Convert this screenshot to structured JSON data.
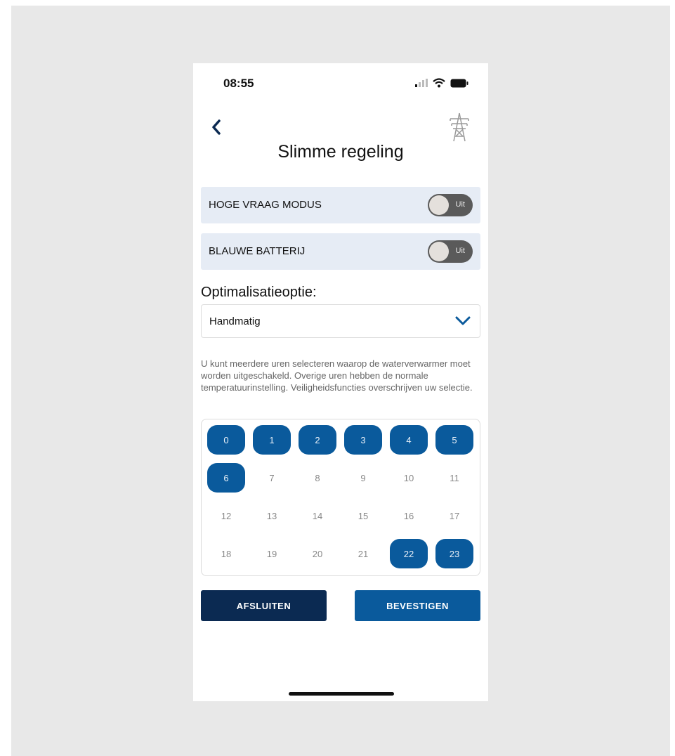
{
  "status_bar": {
    "time": "08:55",
    "icons": [
      "signal-icon",
      "wifi-icon",
      "battery-icon"
    ]
  },
  "header": {
    "back_icon": "chevron-left-icon",
    "right_icon": "power-pylon-icon",
    "title": "Slimme regeling"
  },
  "toggles": [
    {
      "label": "HOGE VRAAG MODUS",
      "state_text": "Uit",
      "on": false
    },
    {
      "label": "BLAUWE BATTERIJ",
      "state_text": "Uit",
      "on": false
    }
  ],
  "optimization": {
    "label": "Optimalisatieoptie:",
    "selected": "Handmatig",
    "chevron_icon": "chevron-down-icon"
  },
  "description": "U kunt meerdere uren selecteren waarop de waterverwarmer moet worden uitgeschakeld. Overige uren hebben de normale temperatuurinstelling. Veiligheidsfuncties overschrijven uw selectie.",
  "hours": [
    {
      "label": "0",
      "selected": true
    },
    {
      "label": "1",
      "selected": true
    },
    {
      "label": "2",
      "selected": true
    },
    {
      "label": "3",
      "selected": true
    },
    {
      "label": "4",
      "selected": true
    },
    {
      "label": "5",
      "selected": true
    },
    {
      "label": "6",
      "selected": true
    },
    {
      "label": "7",
      "selected": false
    },
    {
      "label": "8",
      "selected": false
    },
    {
      "label": "9",
      "selected": false
    },
    {
      "label": "10",
      "selected": false
    },
    {
      "label": "11",
      "selected": false
    },
    {
      "label": "12",
      "selected": false
    },
    {
      "label": "13",
      "selected": false
    },
    {
      "label": "14",
      "selected": false
    },
    {
      "label": "15",
      "selected": false
    },
    {
      "label": "16",
      "selected": false
    },
    {
      "label": "17",
      "selected": false
    },
    {
      "label": "18",
      "selected": false
    },
    {
      "label": "19",
      "selected": false
    },
    {
      "label": "20",
      "selected": false
    },
    {
      "label": "21",
      "selected": false
    },
    {
      "label": "22",
      "selected": true
    },
    {
      "label": "23",
      "selected": true
    }
  ],
  "buttons": {
    "close_label": "AFSLUITEN",
    "confirm_label": "BEVESTIGEN"
  },
  "colors": {
    "primary_blue": "#0a5a9c",
    "dark_navy": "#0b2a52",
    "toggle_row_bg": "#e6ecf5",
    "toggle_off": "#5a5a5a"
  }
}
